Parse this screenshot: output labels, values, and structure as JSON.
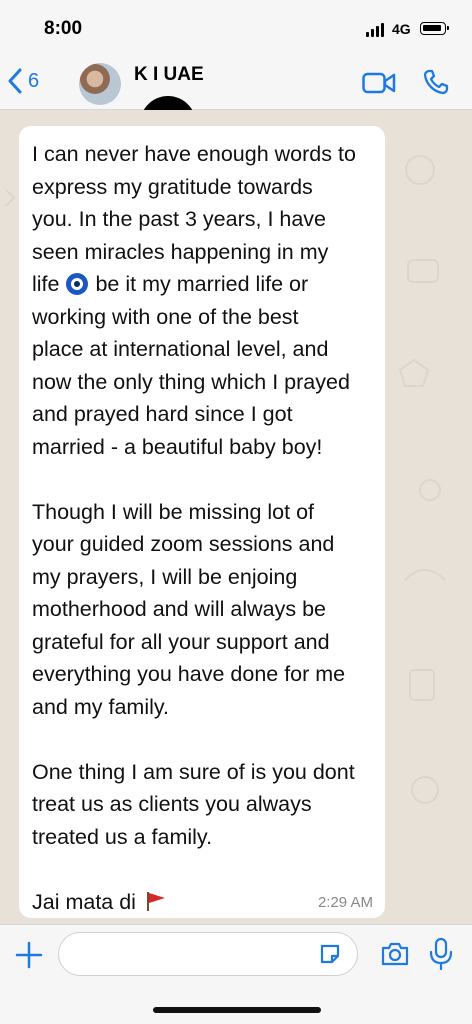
{
  "status_bar": {
    "time": "8:00",
    "network": "4G"
  },
  "header": {
    "back_count": "6",
    "contact_name": "K  I UAE",
    "colors": {
      "accent": "#1f7ae0"
    }
  },
  "message": {
    "paragraphs": [
      [
        "I can never have enough words to",
        "express my gratitude towards",
        "you. In the past 3 years, I have",
        "seen miracles happening in my",
        {
          "before": "life",
          "emoji": "nazar-amulet",
          "after": "be it my married life or"
        },
        "working with one of the best",
        "place at international level, and",
        "now the only thing which I prayed",
        "and prayed hard since I got",
        "married - a beautiful baby boy!"
      ],
      [
        "Though I will be missing lot of",
        "your guided zoom sessions and",
        "my prayers, I will be enjoing",
        "motherhood and will always be",
        "grateful for all your support and",
        "everything you have done for me",
        "and my family."
      ],
      [
        "One thing I am sure of is you dont",
        "treat us as clients you always",
        "treated us a family."
      ],
      [
        {
          "before": "Jai mata di",
          "emoji": "triangular-flag",
          "after": ""
        }
      ]
    ],
    "time": "2:29 AM"
  },
  "input": {
    "placeholder": ""
  },
  "icons": [
    "back-chevron-icon",
    "video-call-icon",
    "phone-icon",
    "plus-icon",
    "sticker-icon",
    "camera-icon",
    "microphone-icon"
  ]
}
